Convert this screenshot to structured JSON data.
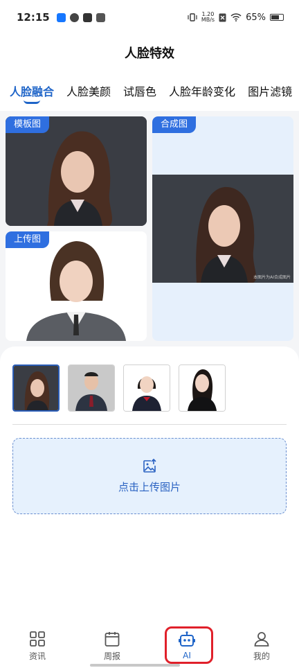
{
  "status_bar": {
    "time": "12:15",
    "net_speed_value": "1.20",
    "net_speed_unit": "MB/s",
    "battery": "65%"
  },
  "header": {
    "title": "人脸特效"
  },
  "tabs": [
    {
      "label": "人脸融合",
      "active": true
    },
    {
      "label": "人脸美颜",
      "active": false
    },
    {
      "label": "试唇色",
      "active": false
    },
    {
      "label": "人脸年龄变化",
      "active": false
    },
    {
      "label": "图片滤镜",
      "active": false
    }
  ],
  "panels": {
    "template_tag": "模板图",
    "upload_tag": "上传图",
    "result_tag": "合成图",
    "result_watermark": "本图片为AI合成图片"
  },
  "thumbnails": [
    {
      "name": "woman-long-hair",
      "selected": true
    },
    {
      "name": "man-suit",
      "selected": false
    },
    {
      "name": "girl-uniform",
      "selected": false
    },
    {
      "name": "woman-black-suit",
      "selected": false
    }
  ],
  "upload": {
    "label": "点击上传图片"
  },
  "bottom_nav": [
    {
      "label": "资讯",
      "icon": "grid-icon",
      "active": false
    },
    {
      "label": "周报",
      "icon": "calendar-icon",
      "active": false
    },
    {
      "label": "AI",
      "icon": "robot-icon",
      "active": true
    },
    {
      "label": "我的",
      "icon": "person-icon",
      "active": false
    }
  ],
  "colors": {
    "accent": "#1e64c8",
    "tag_bg": "#2f6fe0",
    "upload_bg": "#e6f1fd",
    "highlight": "#e0202a"
  }
}
